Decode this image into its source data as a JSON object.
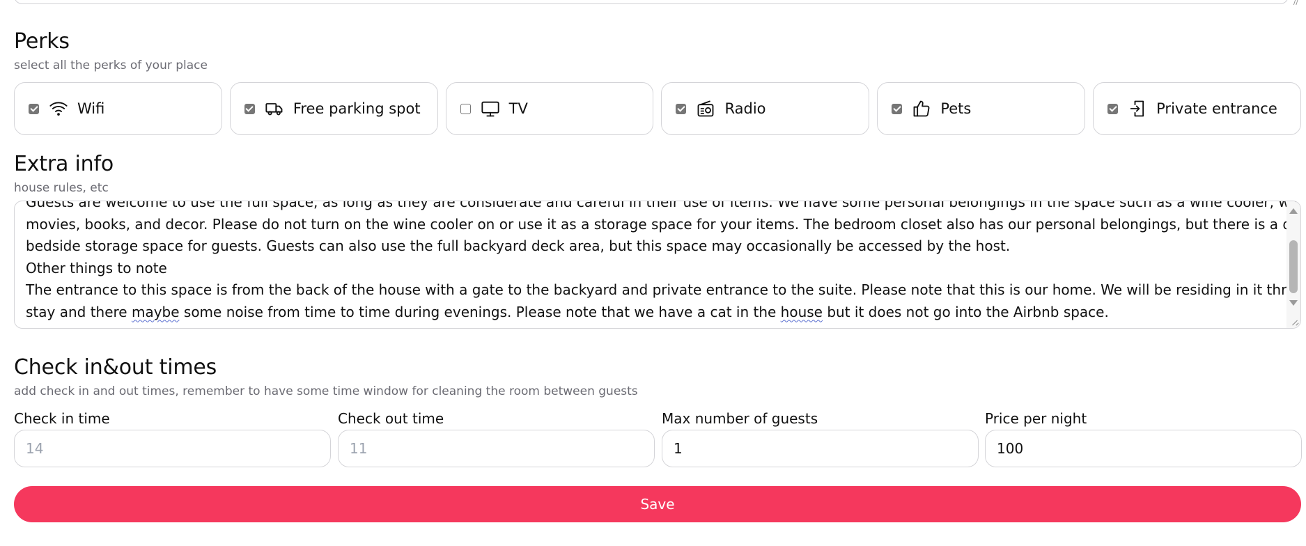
{
  "perks_section": {
    "title": "Perks",
    "subtitle": "select all the perks of your place",
    "items": [
      {
        "label": "Wifi",
        "checked": true,
        "icon": "wifi-icon"
      },
      {
        "label": "Free parking spot",
        "checked": true,
        "icon": "truck-icon"
      },
      {
        "label": "TV",
        "checked": false,
        "icon": "tv-icon"
      },
      {
        "label": "Radio",
        "checked": true,
        "icon": "radio-icon"
      },
      {
        "label": "Pets",
        "checked": true,
        "icon": "thumbs-up-icon"
      },
      {
        "label": "Private entrance",
        "checked": true,
        "icon": "enter-door-icon"
      }
    ]
  },
  "extra_info": {
    "title": "Extra info",
    "subtitle": "house rules, etc",
    "lines": [
      "Guests are welcome to use the full space, as long as they are considerate and careful in their use of items. We have some personal belongings in the space such as a wine cooler, wine glasses,",
      "movies, books, and decor. Please do not turn on the wine cooler on or use it as a storage space for your items. The bedroom closet also has our personal belongings, but there is a dresser and",
      "bedside storage space for guests. Guests can also use the full backyard deck area, but this space may occasionally be accessed by the host.",
      "Other things to note",
      "The entrance to this space is from the back of the house with a gate to the backyard and private entrance to the suite. Please note that this is our home. We will be residing in it throughout your"
    ],
    "last_line_parts": [
      "stay and there ",
      "maybe",
      " some noise from time to time during evenings. Please note that we have a cat in the ",
      "house",
      " but it does not go into the Airbnb space."
    ]
  },
  "checkin_section": {
    "title": "Check in&out times",
    "subtitle": "add check in and out times, remember to have some time window for cleaning the room between guests",
    "fields": [
      {
        "label": "Check in time",
        "value": "",
        "placeholder": "14"
      },
      {
        "label": "Check out time",
        "value": "",
        "placeholder": "11"
      },
      {
        "label": "Max number of guests",
        "value": "1",
        "placeholder": ""
      },
      {
        "label": "Price per night",
        "value": "100",
        "placeholder": ""
      }
    ]
  },
  "save_button": {
    "label": "Save"
  },
  "colors": {
    "accent": "#f5385d",
    "border": "#d4d4d8",
    "muted_text": "#6b6b73"
  }
}
